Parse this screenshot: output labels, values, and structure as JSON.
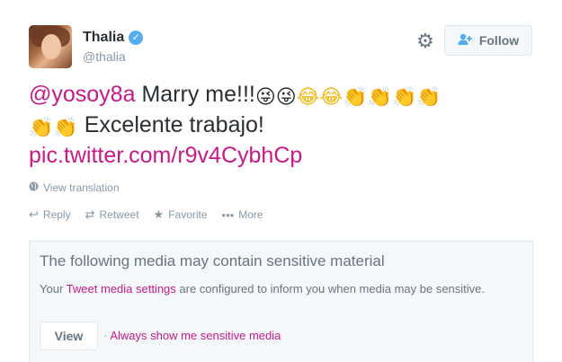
{
  "user": {
    "display_name": "Thalia",
    "handle": "@thalia",
    "verified_glyph": "✓"
  },
  "header": {
    "gear_glyph": "⚙",
    "follow_label": "Follow",
    "follow_icon_glyph": "👤⁺"
  },
  "tweet": {
    "mention": "@yosoy8a",
    "text_a": " Marry me!!!",
    "text_b": " Excelente trabajo!",
    "link": "pic.twitter.com/r9v4CybhCp",
    "emojis": {
      "wink": "😜",
      "laugh": "😂",
      "clap": "👏"
    }
  },
  "translate": {
    "label": "View translation",
    "icon_glyph": "🌐"
  },
  "actions": {
    "reply": {
      "label": "Reply",
      "glyph": "↩"
    },
    "retweet": {
      "label": "Retweet",
      "glyph": "⇄"
    },
    "favorite": {
      "label": "Favorite",
      "glyph": "★"
    },
    "more": {
      "label": "More",
      "glyph": "•••"
    }
  },
  "sensitive": {
    "title": "The following media may contain sensitive material",
    "desc_before": "Your ",
    "desc_link": "Tweet media settings",
    "desc_after": " are configured to inform you when media may be sensitive.",
    "view_label": "View",
    "separator": "·",
    "always_label": "Always show me sensitive media"
  },
  "colors": {
    "link": "#c8198a",
    "verified": "#55acee",
    "muted": "#8899a6"
  }
}
